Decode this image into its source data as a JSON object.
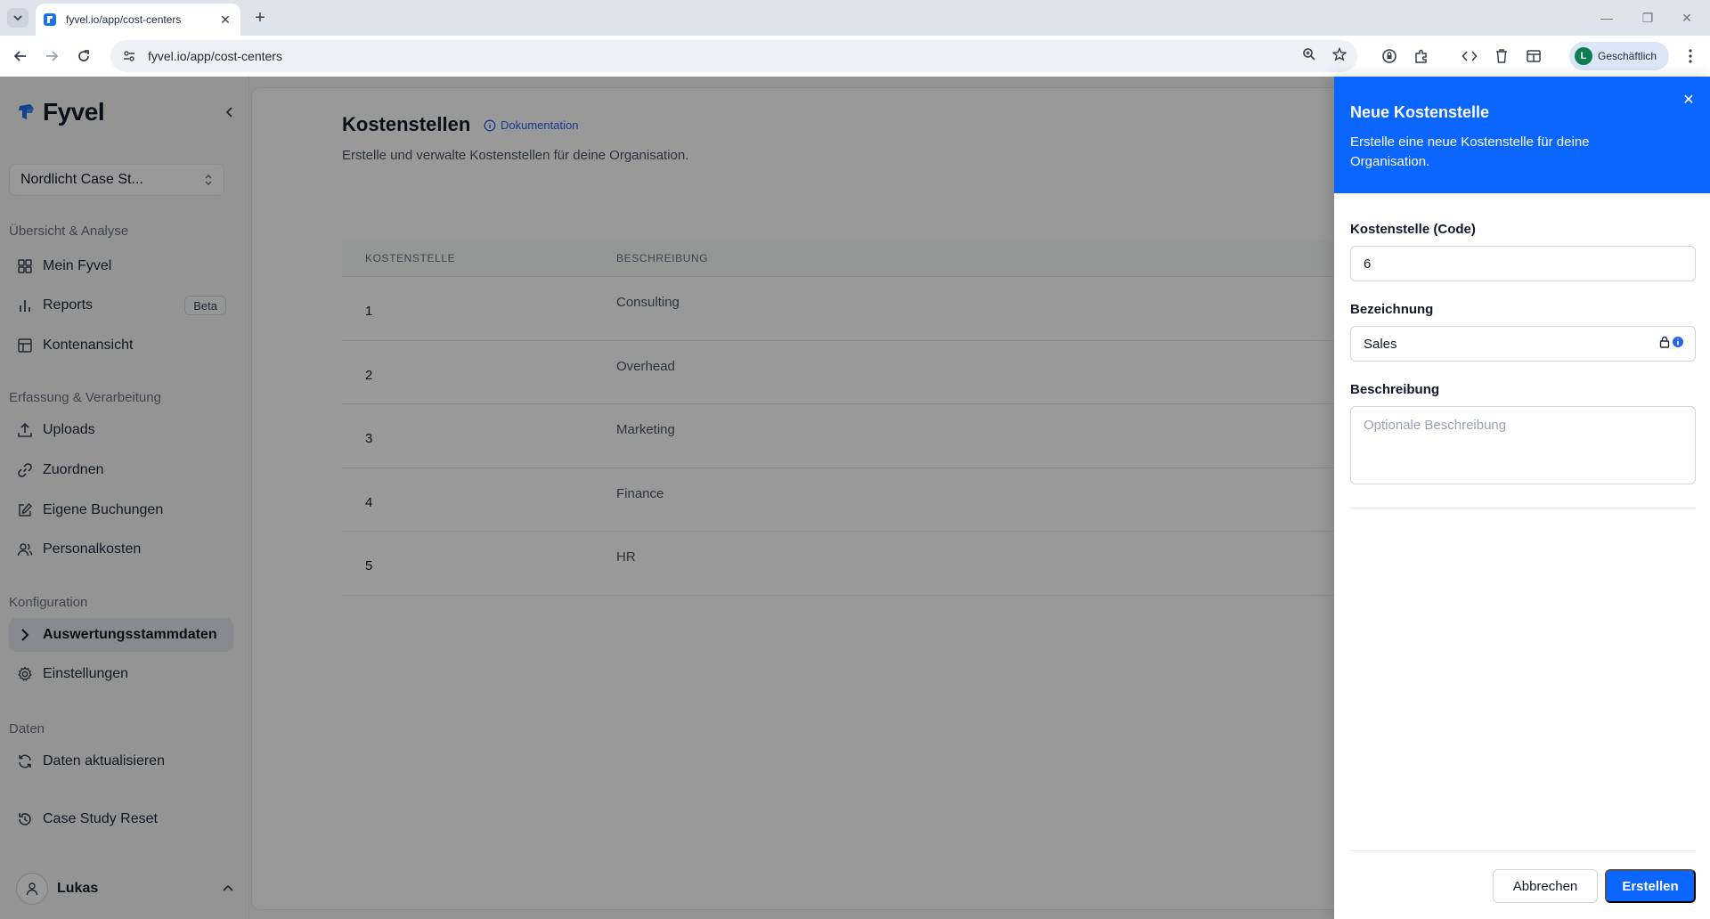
{
  "browser": {
    "tab_title": "fyvel.io/app/cost-centers",
    "url": "fyvel.io/app/cost-centers",
    "profile_initial": "L",
    "profile_name": "Geschäftlich"
  },
  "sidebar": {
    "logo": "Fyvel",
    "org_name": "Nordlicht Case St...",
    "sections": {
      "overview": "Übersicht & Analyse",
      "capture": "Erfassung & Verarbeitung",
      "config": "Konfiguration",
      "data": "Daten"
    },
    "items": {
      "mein_fyvel": "Mein Fyvel",
      "reports": "Reports",
      "reports_badge": "Beta",
      "kontenansicht": "Kontenansicht",
      "uploads": "Uploads",
      "zuordnen": "Zuordnen",
      "eigene_buchungen": "Eigene Buchungen",
      "personalkosten": "Personalkosten",
      "auswertungsstammdaten": "Auswertungsstammdaten",
      "einstellungen": "Einstellungen",
      "daten_aktualisieren": "Daten aktualisieren",
      "case_study_reset": "Case Study Reset"
    },
    "user_name": "Lukas"
  },
  "main": {
    "title": "Kostenstellen",
    "doc_link": "Dokumentation",
    "subtitle": "Erstelle und verwalte Kostenstellen für deine Organisation.",
    "table": {
      "headers": [
        "KOSTENSTELLE",
        "BESCHREIBUNG"
      ],
      "rows": [
        {
          "code": "1",
          "description": "Consulting"
        },
        {
          "code": "2",
          "description": "Overhead"
        },
        {
          "code": "3",
          "description": "Marketing"
        },
        {
          "code": "4",
          "description": "Finance"
        },
        {
          "code": "5",
          "description": "HR"
        }
      ]
    }
  },
  "drawer": {
    "title": "Neue Kostenstelle",
    "description": "Erstelle eine neue Kostenstelle für deine Organisation.",
    "code_label": "Kostenstelle (Code)",
    "code_value": "6",
    "name_label": "Bezeichnung",
    "name_value": "Sales",
    "desc_label": "Beschreibung",
    "desc_placeholder": "Optionale Beschreibung",
    "cancel_label": "Abbrechen",
    "create_label": "Erstellen"
  },
  "colors": {
    "accent": "#0a66ff",
    "link": "#2563eb"
  }
}
